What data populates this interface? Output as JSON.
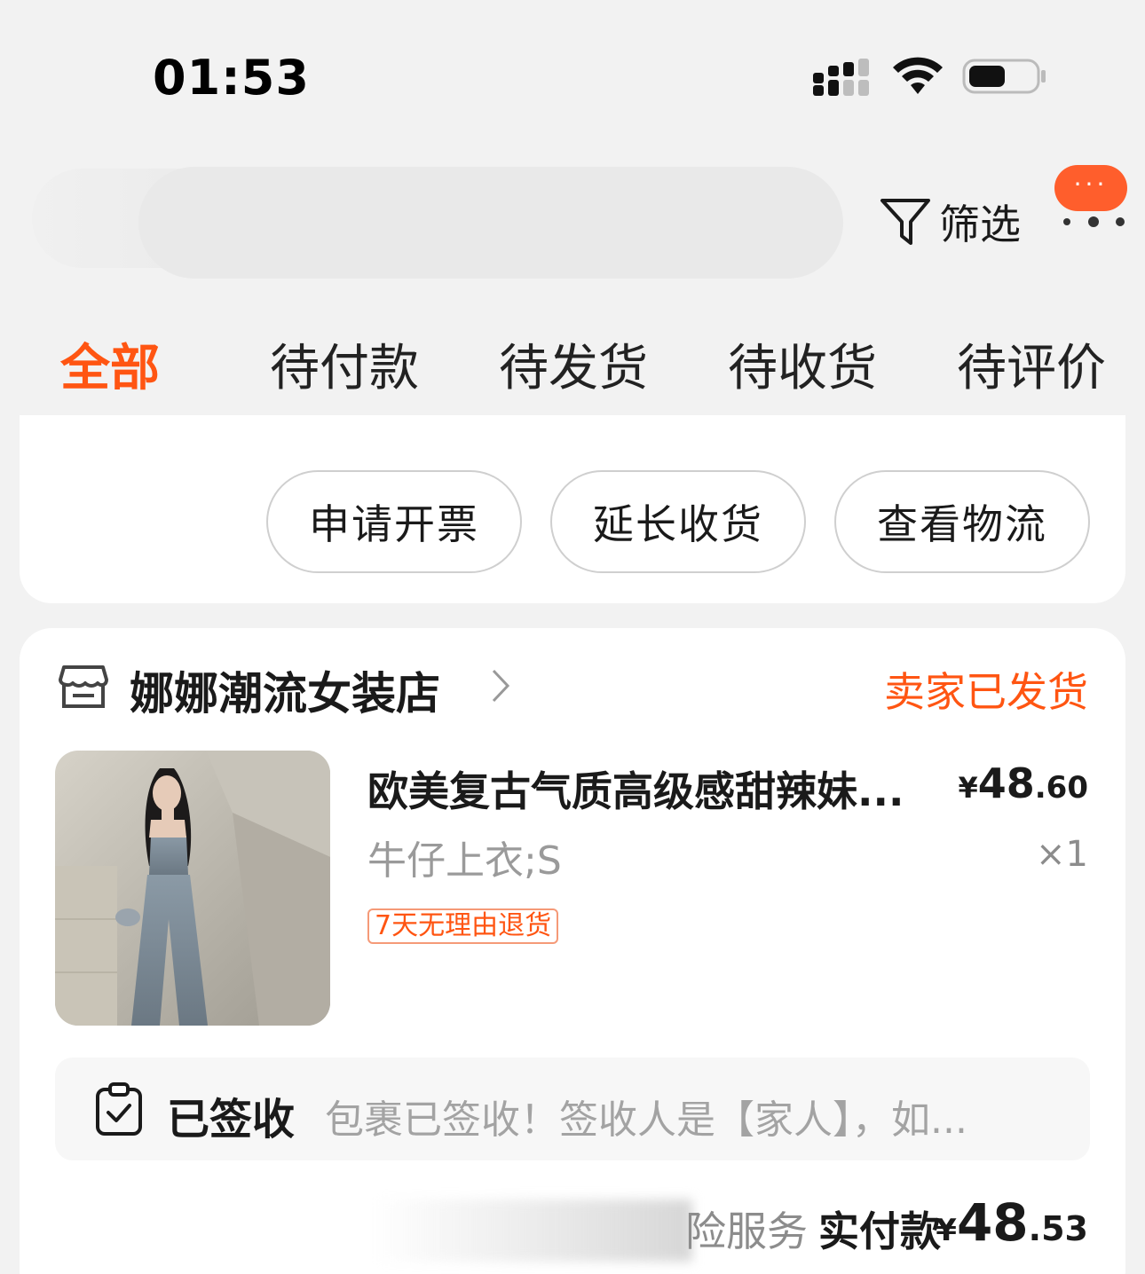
{
  "status_bar": {
    "time": "01:53",
    "signal_icon": "cellular-signal-icon",
    "wifi_icon": "wifi-icon",
    "battery_icon": "battery-icon"
  },
  "header": {
    "filter_label": "筛选",
    "filter_icon": "funnel-icon",
    "more_bubble": "···",
    "more_icon": "more-dots-icon"
  },
  "tabs": [
    {
      "label": "全部",
      "active": true
    },
    {
      "label": "待付款",
      "active": false
    },
    {
      "label": "待发货",
      "active": false
    },
    {
      "label": "待收货",
      "active": false
    },
    {
      "label": "待评价",
      "active": false
    }
  ],
  "previous_order": {
    "actions": [
      "申请开票",
      "延长收货",
      "查看物流"
    ]
  },
  "order": {
    "store_name": "娜娜潮流女装店",
    "store_icon": "store-icon",
    "status": "卖家已发货",
    "product": {
      "title": "欧美复古气质高级感甜辣妹...",
      "spec": "牛仔上衣;S",
      "price_symbol": "¥",
      "price_int": "48",
      "price_dec": ".60",
      "quantity": "×1",
      "tag": "7天无理由退货"
    },
    "logistics": {
      "icon": "clipboard-check-icon",
      "status": "已签收",
      "detail": "包裹已签收！签收人是【家人】，如..."
    },
    "footer": {
      "insurance_text": "险服务",
      "paid_label": "实付款",
      "paid_symbol": "¥",
      "paid_int": "48",
      "paid_dec": ".53"
    }
  },
  "colors": {
    "accent": "#ff5512",
    "background": "#f2f2f2",
    "card": "#ffffff"
  }
}
